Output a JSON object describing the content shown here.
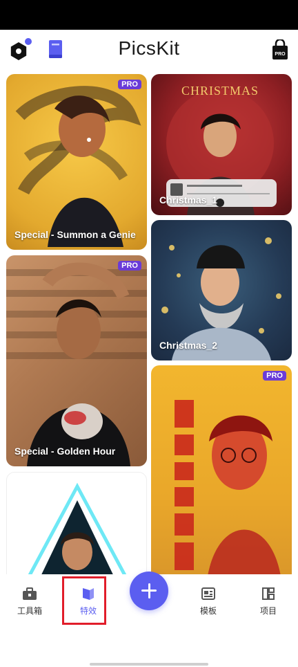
{
  "header": {
    "title": "PicsKit"
  },
  "badges": {
    "pro": "PRO"
  },
  "cards": [
    {
      "label": "Special - Summon a Genie",
      "pro": true
    },
    {
      "label": "Christmas_1",
      "pro": false
    },
    {
      "label": "Christmas_2",
      "pro": false
    },
    {
      "label": "Special - Golden Hour",
      "pro": true
    },
    {
      "label": "",
      "pro": false
    },
    {
      "label": "",
      "pro": true
    }
  ],
  "tabs": [
    {
      "label": "工具箱",
      "icon": "toolbox-icon"
    },
    {
      "label": "特效",
      "icon": "effects-icon",
      "active": true
    },
    {
      "label": "模板",
      "icon": "template-icon"
    },
    {
      "label": "项目",
      "icon": "projects-icon"
    }
  ],
  "colors": {
    "accent": "#5b5ef0",
    "pro_badge": "#6a3bd8",
    "highlight": "#e11d2a"
  }
}
